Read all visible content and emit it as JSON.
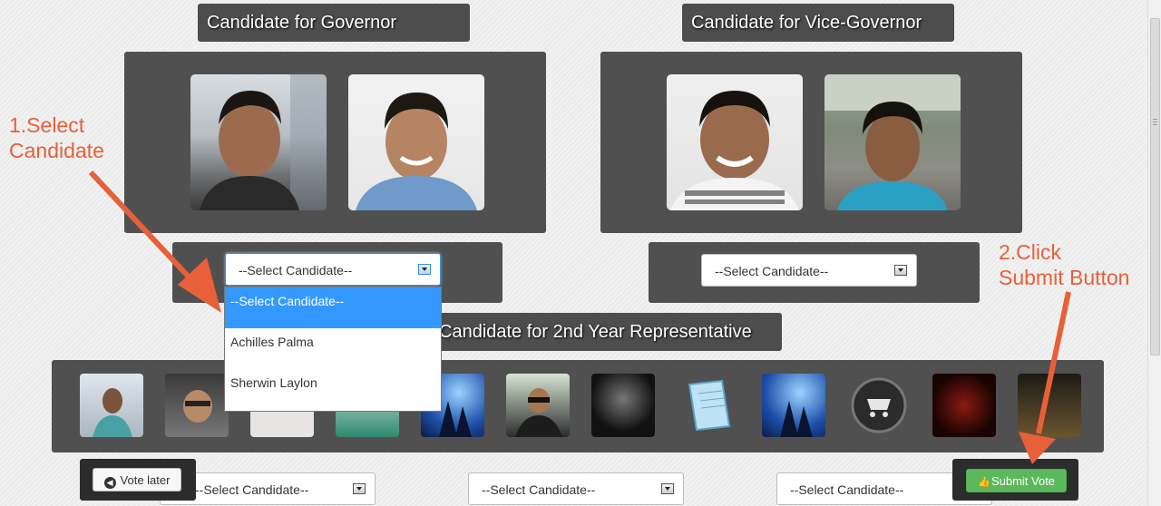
{
  "governor": {
    "title": "Candidate for Governor",
    "select_value": "--Select Candidate--",
    "options": [
      "--Select Candidate--",
      "Achilles Palma",
      "Sherwin Laylon"
    ]
  },
  "vice_governor": {
    "title": "Candidate for Vice-Governor",
    "select_value": "--Select Candidate--"
  },
  "representative": {
    "title": "Candidate for 2nd Year Representative",
    "select_value_left": "--Select Candidate--",
    "select_value_mid": "--Select Candidate--",
    "select_value_right": "--Select Candidate--"
  },
  "annotations": {
    "step1_line1": "1.Select",
    "step1_line2": "Candidate",
    "step2_line1": "2.Click",
    "step2_line2": "Submit Button",
    "color": "#e8603a"
  },
  "buttons": {
    "vote_later": "Vote later",
    "submit_vote": "Submit Vote"
  },
  "colors": {
    "panel": "#505050",
    "dropdown_highlight": "#3399ff",
    "submit_button": "#5cb85c"
  }
}
